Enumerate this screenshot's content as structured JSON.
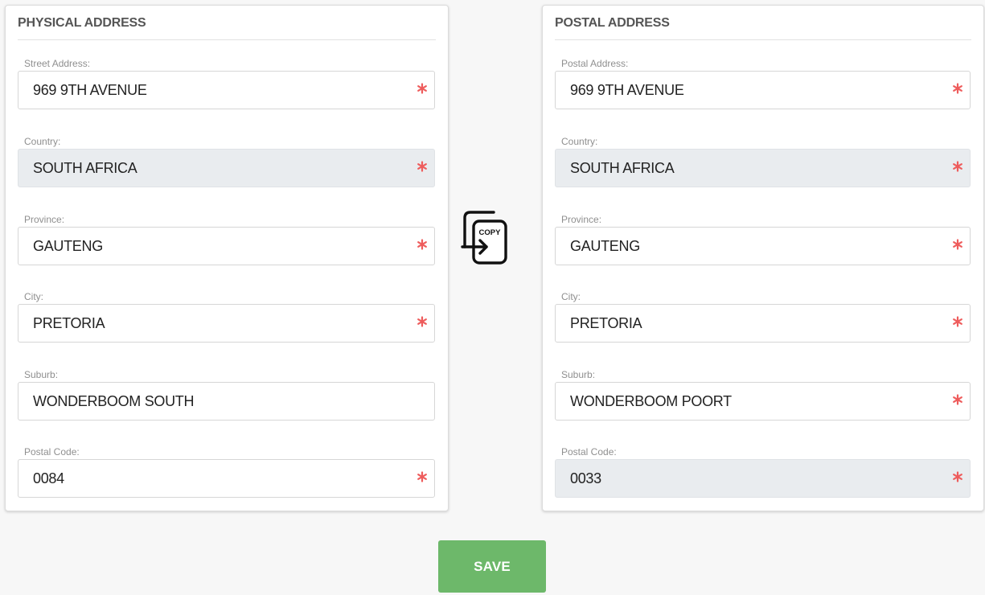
{
  "physical": {
    "title": "PHYSICAL ADDRESS",
    "fields": [
      {
        "label": "Street Address:",
        "value": "969 9TH AVENUE",
        "required": true,
        "readonly": false
      },
      {
        "label": "Country:",
        "value": "SOUTH AFRICA",
        "required": true,
        "readonly": true
      },
      {
        "label": "Province:",
        "value": "GAUTENG",
        "required": true,
        "readonly": false
      },
      {
        "label": "City:",
        "value": "PRETORIA",
        "required": true,
        "readonly": false
      },
      {
        "label": "Suburb:",
        "value": "WONDERBOOM SOUTH",
        "required": false,
        "readonly": false
      },
      {
        "label": "Postal Code:",
        "value": "0084",
        "required": true,
        "readonly": false
      }
    ]
  },
  "postal": {
    "title": "POSTAL ADDRESS",
    "fields": [
      {
        "label": "Postal Address:",
        "value": "969 9TH AVENUE",
        "required": true,
        "readonly": false
      },
      {
        "label": "Country:",
        "value": "SOUTH AFRICA",
        "required": true,
        "readonly": true
      },
      {
        "label": "Province:",
        "value": "GAUTENG",
        "required": true,
        "readonly": false
      },
      {
        "label": "City:",
        "value": "PRETORIA",
        "required": true,
        "readonly": false
      },
      {
        "label": "Suburb:",
        "value": "WONDERBOOM POORT",
        "required": true,
        "readonly": false
      },
      {
        "label": "Postal Code:",
        "value": "0033",
        "required": true,
        "readonly": true
      }
    ]
  },
  "copy_button": {
    "icon": "copy-icon",
    "text": "COPY"
  },
  "save_button": {
    "label": "SAVE"
  },
  "colors": {
    "save": "#6db86a",
    "required": "#ee5c5c",
    "readonly_bg": "#e9ecef"
  }
}
